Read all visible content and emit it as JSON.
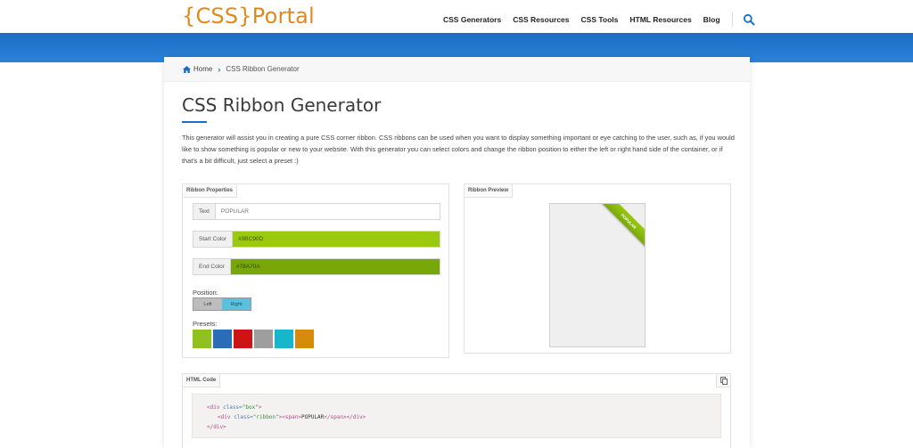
{
  "header": {
    "logo": "{CSS}Portal",
    "nav": [
      "CSS Generators",
      "CSS Resources",
      "CSS Tools",
      "HTML Resources",
      "Blog"
    ],
    "search_icon": "search-icon",
    "brand_color": "#e08a1e",
    "bar_color": "#1a6fc4"
  },
  "breadcrumb": {
    "home": "Home",
    "current": "CSS Ribbon Generator"
  },
  "page": {
    "title": "CSS Ribbon Generator",
    "description": "This generator will assist you in creating a pure CSS corner ribbon. CSS ribbons can be used when you want to display something important or eye catching to the user, such as, if you would like to show something is popular or new to your website. With this generator you can select colors and change the ribbon position to either the left or right hand side of the container, or if that's a bit difficult, just select a preset :)"
  },
  "properties": {
    "tab": "Ribbon Properties",
    "text_label": "Text",
    "text_value": "POPULAR",
    "start_label": "Start Color",
    "start_value": "#9BC90D",
    "end_label": "End Color",
    "end_value": "#78A70A",
    "position_label": "Position:",
    "position_left": "Left",
    "position_right": "Right",
    "presets_label": "Presets:",
    "presets": [
      "#8fc11f",
      "#2b6cb8",
      "#cc1414",
      "#9e9e9e",
      "#16b6cc",
      "#d88a0c"
    ]
  },
  "preview": {
    "tab": "Ribbon Preview",
    "ribbon_text": "POPULAR"
  },
  "code": {
    "tab": "HTML Code",
    "copy_icon": "copy-icon",
    "line1": {
      "open": "<div ",
      "attr": "class=",
      "val": "\"box\"",
      "close": ">"
    },
    "line2": {
      "open": "<div ",
      "attr": "class=",
      "val": "\"ribbon\"",
      "close": ">",
      "span_open": "<span>",
      "text": "POPULAR",
      "span_close": "</span>",
      "div_close": "</div>"
    },
    "line3": "</div>"
  }
}
